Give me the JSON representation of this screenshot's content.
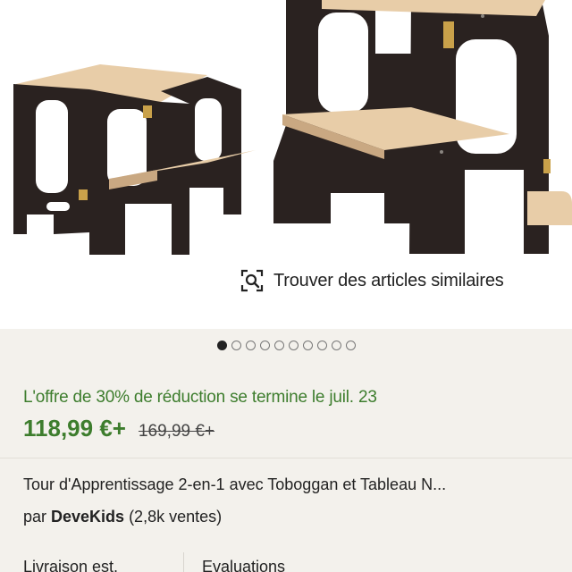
{
  "find_similar": {
    "label": "Trouver des articles similaires",
    "icon": "visual-search-icon"
  },
  "carousel": {
    "total": 10,
    "active_index": 0
  },
  "offer": {
    "promo_text": "L'offre de 30% de réduction se termine le juil. 23",
    "price": "118,99 €+",
    "original_price": "169,99 €+"
  },
  "listing": {
    "title": "Tour d'Apprentissage 2-en-1 avec Toboggan et Tableau N...",
    "seller_prefix": "par",
    "seller_name": "DeveKids",
    "seller_sales": "(2,8k ventes)"
  },
  "tabs": [
    {
      "label": "Livraison est."
    },
    {
      "label": "Evaluations"
    }
  ],
  "colors": {
    "accent_green": "#3d7d2d",
    "panel_bg": "#f3f1ec",
    "wood_dark": "#2a2220",
    "wood_light": "#e8cda8"
  }
}
